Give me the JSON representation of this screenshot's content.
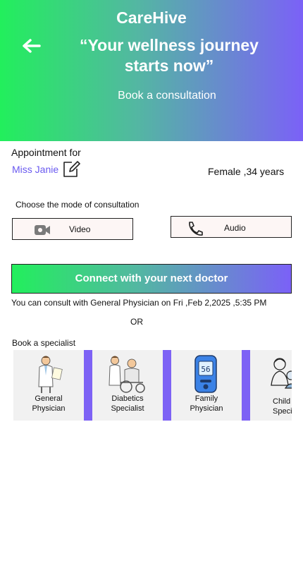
{
  "header": {
    "brand": "CareHive",
    "tagline": "“Your wellness journey starts now”",
    "subtitle": "Book a consultation",
    "back_icon": "back-arrow-icon"
  },
  "appointment": {
    "label": "Appointment for",
    "patient_name": "Miss Janie",
    "patient_info": "Female ,34 years",
    "edit_icon": "edit-icon"
  },
  "consultation_mode": {
    "label": "Choose the mode of  consultation",
    "options": [
      {
        "label": "Video",
        "icon": "video-camera-icon"
      },
      {
        "label": "Audio",
        "icon": "phone-icon"
      }
    ]
  },
  "connect": {
    "label": "Connect with your next doctor",
    "note": "You can consult with General Physician on Fri ,Feb 2,2025 ,5:35 PM"
  },
  "or_text": "OR",
  "specialists": {
    "label": "Book a specialist",
    "items": [
      {
        "line1": "General",
        "line2": "Physician",
        "icon": "doctor-icon"
      },
      {
        "line1": "Diabetics",
        "line2": "Specialist",
        "icon": "doctor-patient-icon"
      },
      {
        "line1": "Family",
        "line2": "Physician",
        "icon": "glucometer-icon",
        "reading": "56"
      },
      {
        "line1": "Child",
        "line2": "Specialist",
        "icon": "child-care-icon"
      }
    ],
    "accent": "#7d62f5"
  },
  "colors": {
    "gradient_start": "#22ef5c",
    "gradient_end": "#7b61f7",
    "name_color": "#6a5af0"
  }
}
